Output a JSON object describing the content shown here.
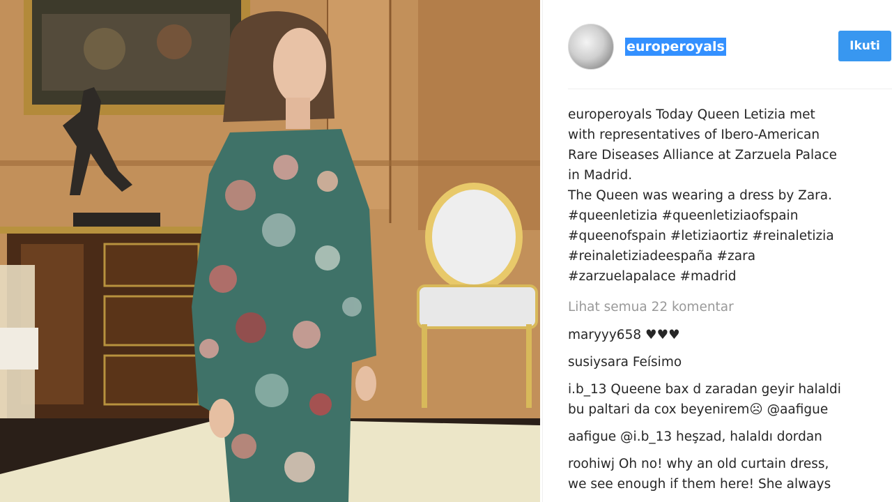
{
  "post": {
    "username": "europeroyals",
    "follow_label": "Ikuti",
    "caption_lines": [
      "europeroyals Today Queen Letizia met",
      "with representatives of Ibero-American",
      "Rare Diseases Alliance at Zarzuela Palace",
      "in Madrid.",
      "The Queen was wearing a dress by Zara.",
      "#queenletizia #queenletiziaofspain",
      "#queenofspain #letiziaortiz #reinaletizia",
      "#reinaletiziadeespaña #zara",
      "#zarzuelapalace #madrid"
    ],
    "view_all_comments": "Lihat semua 22 komentar"
  },
  "comments": [
    {
      "lines": [
        "maryyy658 ♥♥♥"
      ]
    },
    {
      "lines": [
        "susiysara Feísimo"
      ]
    },
    {
      "lines": [
        "i.b_13 Queene bax d zaradan geyir halaldi",
        "bu paltari da cox beyenirem☹ @aafigue"
      ]
    },
    {
      "lines": [
        "aafigue @i.b_13 heşzad, halaldı dordan"
      ]
    },
    {
      "lines": [
        "roohiwj Oh no! why an old curtain dress,",
        "we see enough if them here! She always"
      ]
    }
  ],
  "icons": {
    "avatar": "profile-photo"
  },
  "colors": {
    "follow_button": "#3897f0",
    "username_highlight": "#3390ff",
    "muted_text": "#999999"
  }
}
